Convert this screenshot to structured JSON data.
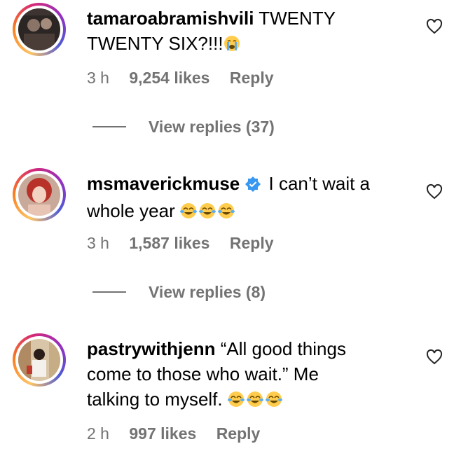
{
  "comments": [
    {
      "username": "tamaroabramishvili",
      "verified": false,
      "text_lines": [
        "TWENTY",
        "TWENTY SIX?!!!"
      ],
      "emoji": "loudly-crying-face",
      "time": "3 h",
      "likes": "9,254 likes",
      "reply": "Reply",
      "view_replies": "View replies (37)"
    },
    {
      "username": "msmaverickmuse",
      "verified": true,
      "text_lines": [
        "I can’t wait a",
        "whole year"
      ],
      "emoji": "tears-of-joy x3",
      "time": "3 h",
      "likes": "1,587 likes",
      "reply": "Reply",
      "view_replies": "View replies (8)"
    },
    {
      "username": "pastrywithjenn",
      "verified": false,
      "text_lines": [
        "“All good things",
        "come to those who wait.” Me",
        "talking to myself."
      ],
      "emoji": "tears-of-joy x3",
      "time": "2 h",
      "likes": "997 likes",
      "reply": "Reply"
    }
  ],
  "colors": {
    "text": "#000000",
    "meta": "#737373",
    "verified": "#3897f0"
  }
}
